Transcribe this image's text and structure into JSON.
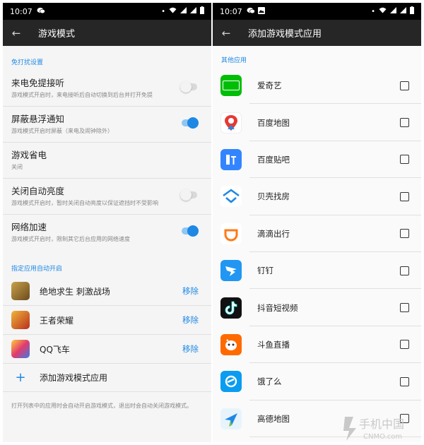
{
  "left": {
    "status": {
      "time": "10:07",
      "battery": "▮"
    },
    "title": "游戏模式",
    "section1": "免打扰设置",
    "settings": [
      {
        "title": "来电免提接听",
        "sub": "游戏模式开启时，来电接听后自动切换到后台并打开免提",
        "on": false
      },
      {
        "title": "屏蔽悬浮通知",
        "sub": "游戏模式开启时屏蔽（来电及闹钟除外）",
        "on": true
      },
      {
        "title": "游戏省电",
        "sub": "关闭"
      },
      {
        "title": "关闭自动亮度",
        "sub": "游戏模式开启时，暂时关闭自动亮度以保证遮挡时不受影响",
        "on": false
      },
      {
        "title": "网络加速",
        "sub": "游戏模式开启时，限制其它后台应用的网络速度",
        "on": true
      }
    ],
    "section2": "指定应用自动开启",
    "apps": [
      {
        "name": "绝地求生 刺激战场",
        "action": "移除"
      },
      {
        "name": "王者荣耀",
        "action": "移除"
      },
      {
        "name": "QQ飞车",
        "action": "移除"
      }
    ],
    "add_label": "添加游戏模式应用",
    "footnote": "打开列表中的应用时会自动开启游戏模式，退出时会自动关闭游戏模式。"
  },
  "right": {
    "status": {
      "time": "10:07"
    },
    "title": "添加游戏模式应用",
    "section": "其他应用",
    "apps": [
      {
        "name": "爱奇艺",
        "color": "#00be06"
      },
      {
        "name": "百度地图",
        "color": "#ffffff"
      },
      {
        "name": "百度贴吧",
        "color": "#3385ff"
      },
      {
        "name": "贝壳找房",
        "color": "#ffffff"
      },
      {
        "name": "滴滴出行",
        "color": "#ffffff"
      },
      {
        "name": "钉钉",
        "color": "#2196f3"
      },
      {
        "name": "抖音短视频",
        "color": "#111111"
      },
      {
        "name": "斗鱼直播",
        "color": "#ff6a00"
      },
      {
        "name": "饿了么",
        "color": "#0a9cf0"
      },
      {
        "name": "高德地图",
        "color": "#e8f4fb"
      }
    ]
  },
  "watermark": {
    "cn": "手机中国",
    "en": "CNMO.com"
  }
}
